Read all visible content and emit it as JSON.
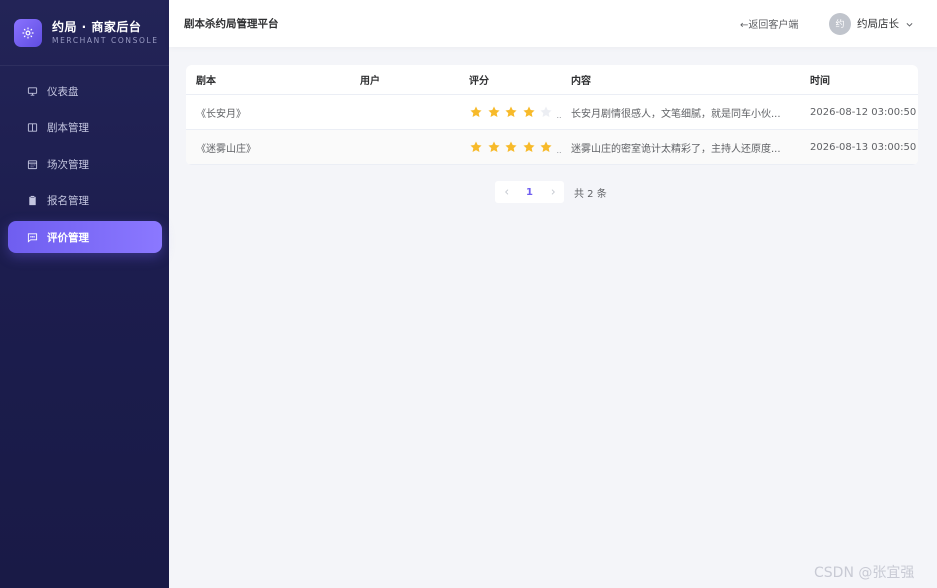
{
  "sidebar": {
    "brand_title": "约局 · 商家后台",
    "brand_subtitle": "MERCHANT CONSOLE",
    "items": [
      {
        "label": "仪表盘",
        "icon": "monitor-icon"
      },
      {
        "label": "剧本管理",
        "icon": "book-icon"
      },
      {
        "label": "场次管理",
        "icon": "calendar-icon"
      },
      {
        "label": "报名管理",
        "icon": "clipboard-icon"
      },
      {
        "label": "评价管理",
        "icon": "chat-icon",
        "active": true
      }
    ]
  },
  "header": {
    "title": "剧本杀约局管理平台",
    "back_link": "←返回客户端",
    "avatar_text": "约",
    "user_name": "约局店长"
  },
  "table": {
    "headers": [
      "剧本",
      "用户",
      "评分",
      "内容",
      "时间"
    ],
    "rows": [
      {
        "script": "《长安月》",
        "user": "",
        "rating": 4,
        "content": "长安月剧情很感人，文笔细腻，就是同车小伙...",
        "time": "2026-08-12 03:00:50"
      },
      {
        "script": "《迷雾山庄》",
        "user": "",
        "rating": 5,
        "content": "迷雾山庄的密室诡计太精彩了，主持人还原度...",
        "time": "2026-08-13 03:00:50"
      }
    ],
    "rating_max": 5
  },
  "pagination": {
    "current_page": "1",
    "total_text": "共 2 条"
  },
  "watermark": "CSDN @张宜强",
  "colors": {
    "accent": "#6f5ef0",
    "star_on": "#f7ba2a",
    "star_off": "#eceef3",
    "sidebar_bg": "#1c1d4e"
  }
}
